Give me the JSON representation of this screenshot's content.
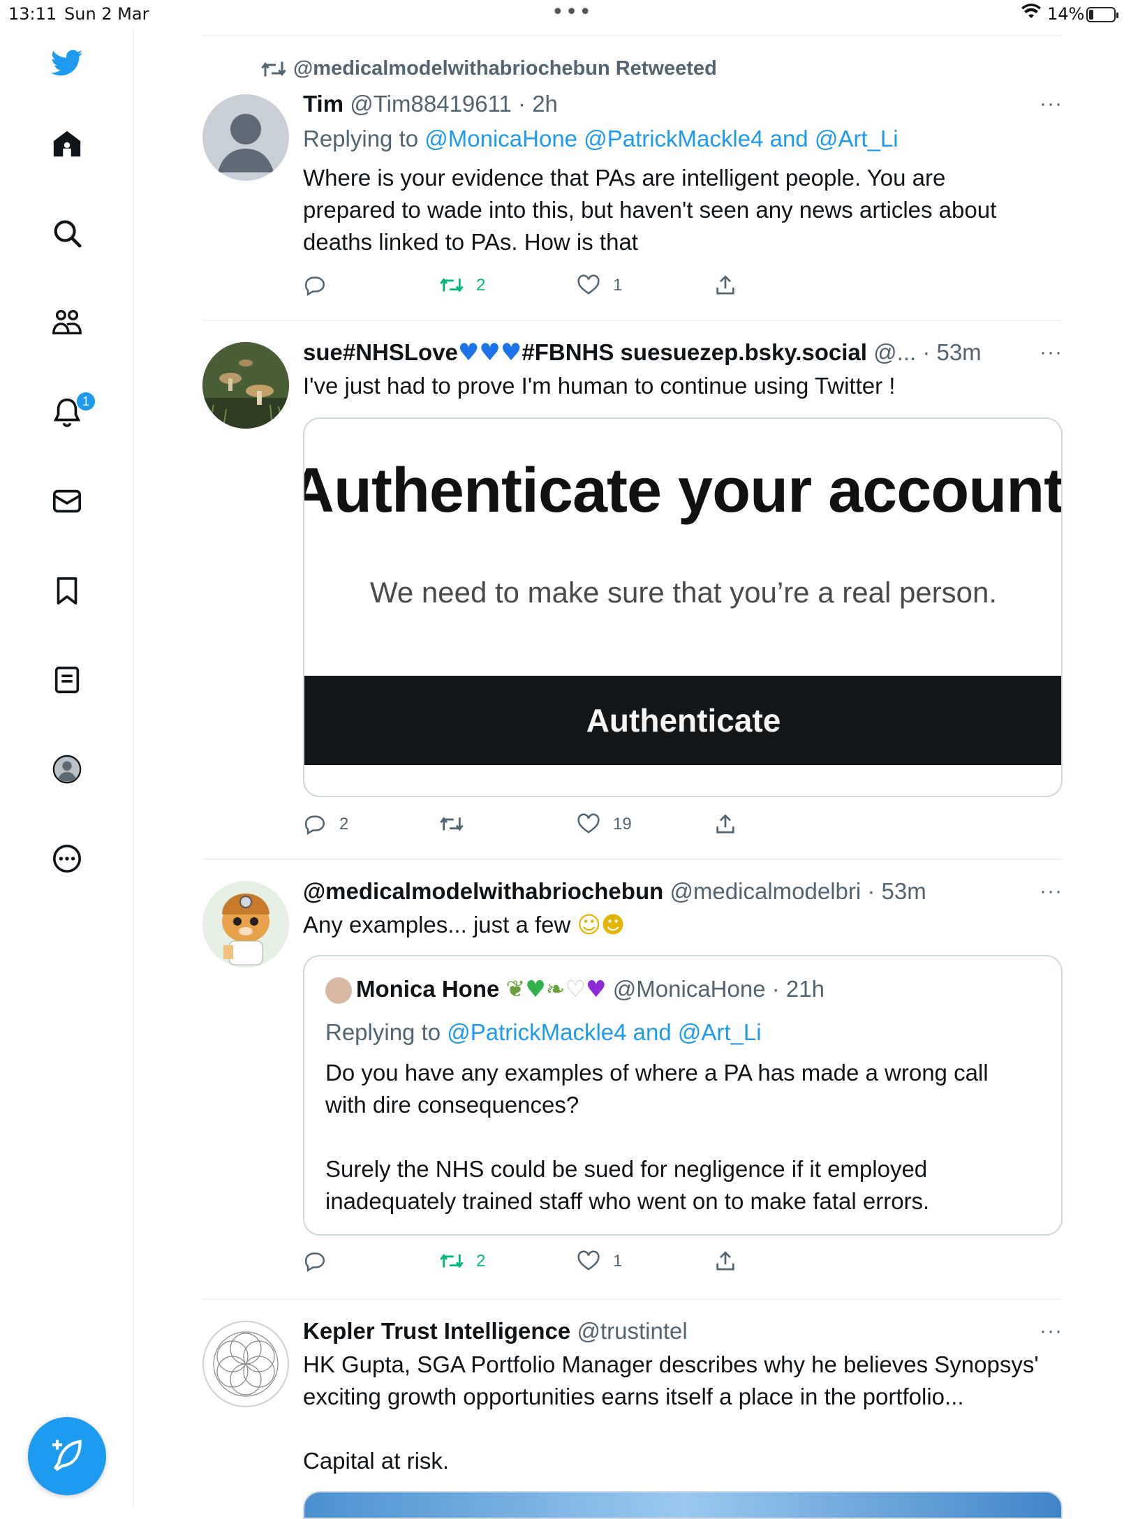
{
  "status": {
    "time": "13:11",
    "date": "Sun 2 Mar",
    "battery": "14%"
  },
  "sidebar": {
    "items": [
      {
        "name": "twitter-logo-icon"
      },
      {
        "name": "home-icon"
      },
      {
        "name": "search-icon"
      },
      {
        "name": "communities-icon"
      },
      {
        "name": "notifications-icon",
        "badge": "1"
      },
      {
        "name": "messages-icon"
      },
      {
        "name": "bookmarks-icon"
      },
      {
        "name": "lists-icon"
      },
      {
        "name": "profile-icon"
      },
      {
        "name": "more-icon"
      }
    ]
  },
  "tweets": [
    {
      "retweeted_by": "@medicalmodelwithabriochebun Retweeted",
      "name": "Tim",
      "handle_time": "@Tim88419611 · 2h",
      "replying_label": "Replying to ",
      "replying_links": "@MonicaHone @PatrickMackle4 and @Art_Li",
      "text": "Where is your evidence that PAs are intelligent people. You are prepared to wade into this, but haven't seen any news articles about deaths linked to PAs. How is that",
      "replies": "",
      "retweets": "2",
      "likes": "1"
    },
    {
      "name_prefix": "sue#NHSLove",
      "name_suffix": "#FBNHS suesuezep.bsky.social",
      "handle_time": "@... · 53m",
      "text": "I've just had to prove I'm human to continue using Twitter !",
      "card": {
        "title": "Authenticate your account",
        "subtitle": "We need to make sure that you’re a real person.",
        "button": "Authenticate"
      },
      "replies": "2",
      "retweets": "",
      "likes": "19"
    },
    {
      "name": "@medicalmodelwithabriochebun",
      "handle_time": "@medicalmodelbri · 53m",
      "text": "Any examples... just a few",
      "quote": {
        "name": "Monica Hone",
        "handle_time": "@MonicaHone · 21h",
        "replying_label": "Replying to ",
        "replying_links": "@PatrickMackle4 and @Art_Li",
        "text1": "Do you have any examples of where a PA has made a wrong call with dire consequences?",
        "text2": "Surely the NHS could be sued for negligence if it employed inadequately trained staff who went on to make fatal errors."
      },
      "replies": "",
      "retweets": "2",
      "likes": "1"
    },
    {
      "name": "Kepler Trust Intelligence",
      "handle_time": "@trustintel",
      "text1": "HK Gupta, SGA Portfolio Manager describes why he believes Synopsys' exciting growth opportunities earns itself a place in the portfolio...",
      "text2": "Capital at risk."
    }
  ],
  "colors": {
    "accent": "#1d9bf0",
    "retweet_green": "#00ba7c",
    "muted": "#536471"
  }
}
